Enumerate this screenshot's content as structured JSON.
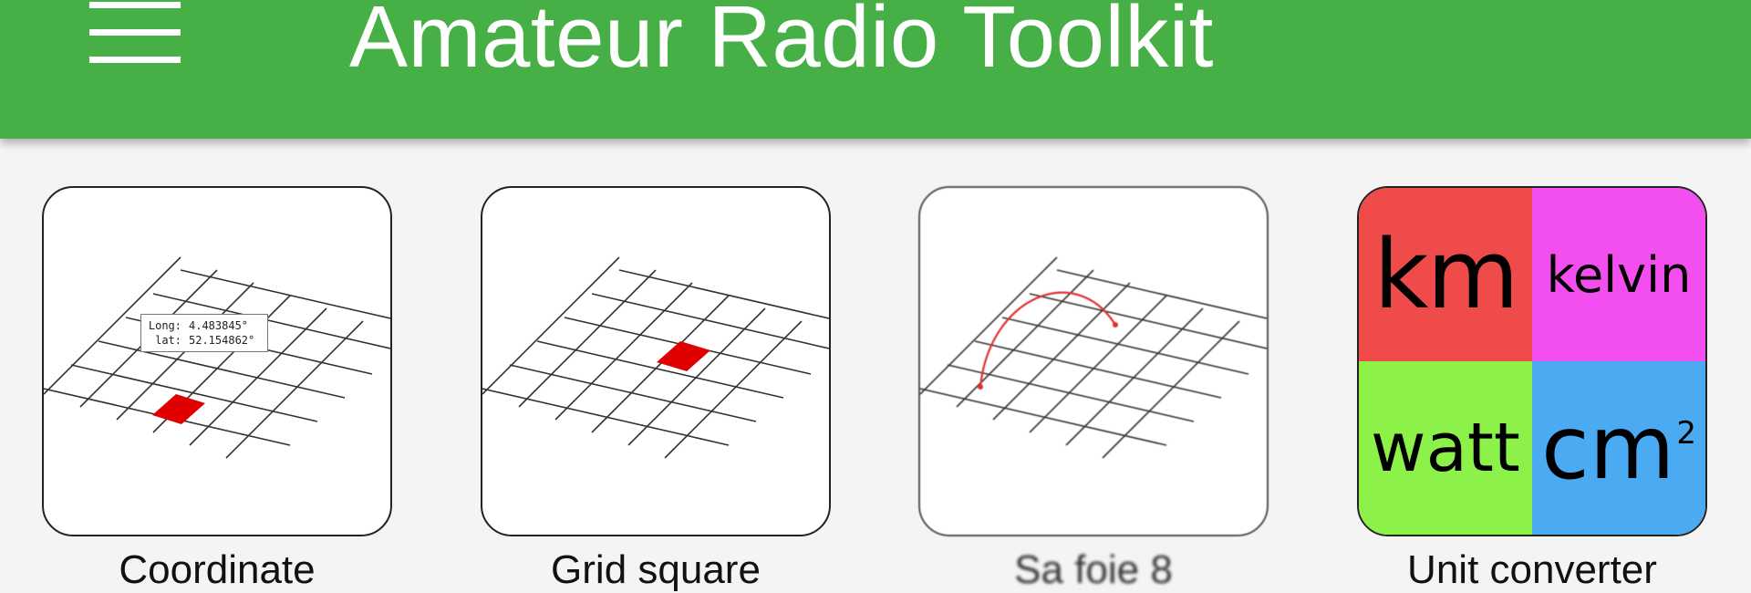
{
  "app": {
    "title": "Amateur Radio Toolkit"
  },
  "colors": {
    "appbar": "#46b046",
    "grid_highlight": "#e00000",
    "arc": "#e03030",
    "unit_km": "#f04b4b",
    "unit_kelvin": "#f34ef0",
    "unit_watt": "#8cf24a",
    "unit_cm": "#4aaaf2"
  },
  "icons": {
    "menu": "hamburger-menu-icon"
  },
  "tiles": [
    {
      "label": "Coordinate",
      "icon": "coordinate-map-icon",
      "coords": {
        "long_key": "Long:",
        "long_val": "4.483845°",
        "lat_key": "lat:",
        "lat_val": "52.154862°"
      }
    },
    {
      "label": "Grid square",
      "icon": "grid-square-icon"
    },
    {
      "label": "Sa foie 8",
      "icon": "great-circle-arc-icon"
    },
    {
      "label": "Unit converter",
      "icon": "unit-converter-icon",
      "units": {
        "km": "km",
        "kelvin": "kelvin",
        "watt": "watt",
        "cm": "cm",
        "cm_exp": "2"
      }
    }
  ]
}
